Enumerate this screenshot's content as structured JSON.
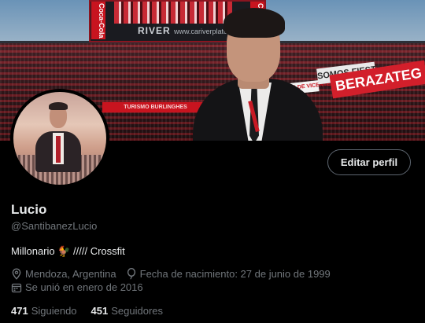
{
  "header": {
    "scoreboard_brand": "RIVER",
    "scoreboard_site": "www.cariverplate.com.ar",
    "side_logo": "Coca-Cola",
    "ads": {
      "somos": "SOMOS FIESTA",
      "berazategui": "BERAZATEG",
      "small": "SOMOS DE VICENTE",
      "row": "TURISMO BURLINGHES"
    }
  },
  "profile": {
    "edit_button": "Editar perfil",
    "name": "Lucio",
    "handle": "@SantibanezLucio",
    "bio": "Millonario 🐓 ///// Crossfit",
    "location": "Mendoza, Argentina",
    "birthday": "Fecha de nacimiento: 27 de junio de 1999",
    "joined": "Se unió en enero de 2016",
    "following_count": "471",
    "following_label": "Siguiendo",
    "followers_count": "451",
    "followers_label": "Seguidores"
  },
  "icons": {
    "location": "location-pin-icon",
    "birthday": "balloon-icon",
    "joined": "calendar-icon"
  },
  "colors": {
    "background": "#000000",
    "text_primary": "#e7e9ea",
    "text_secondary": "#71767b",
    "button_border": "#5e6670"
  }
}
